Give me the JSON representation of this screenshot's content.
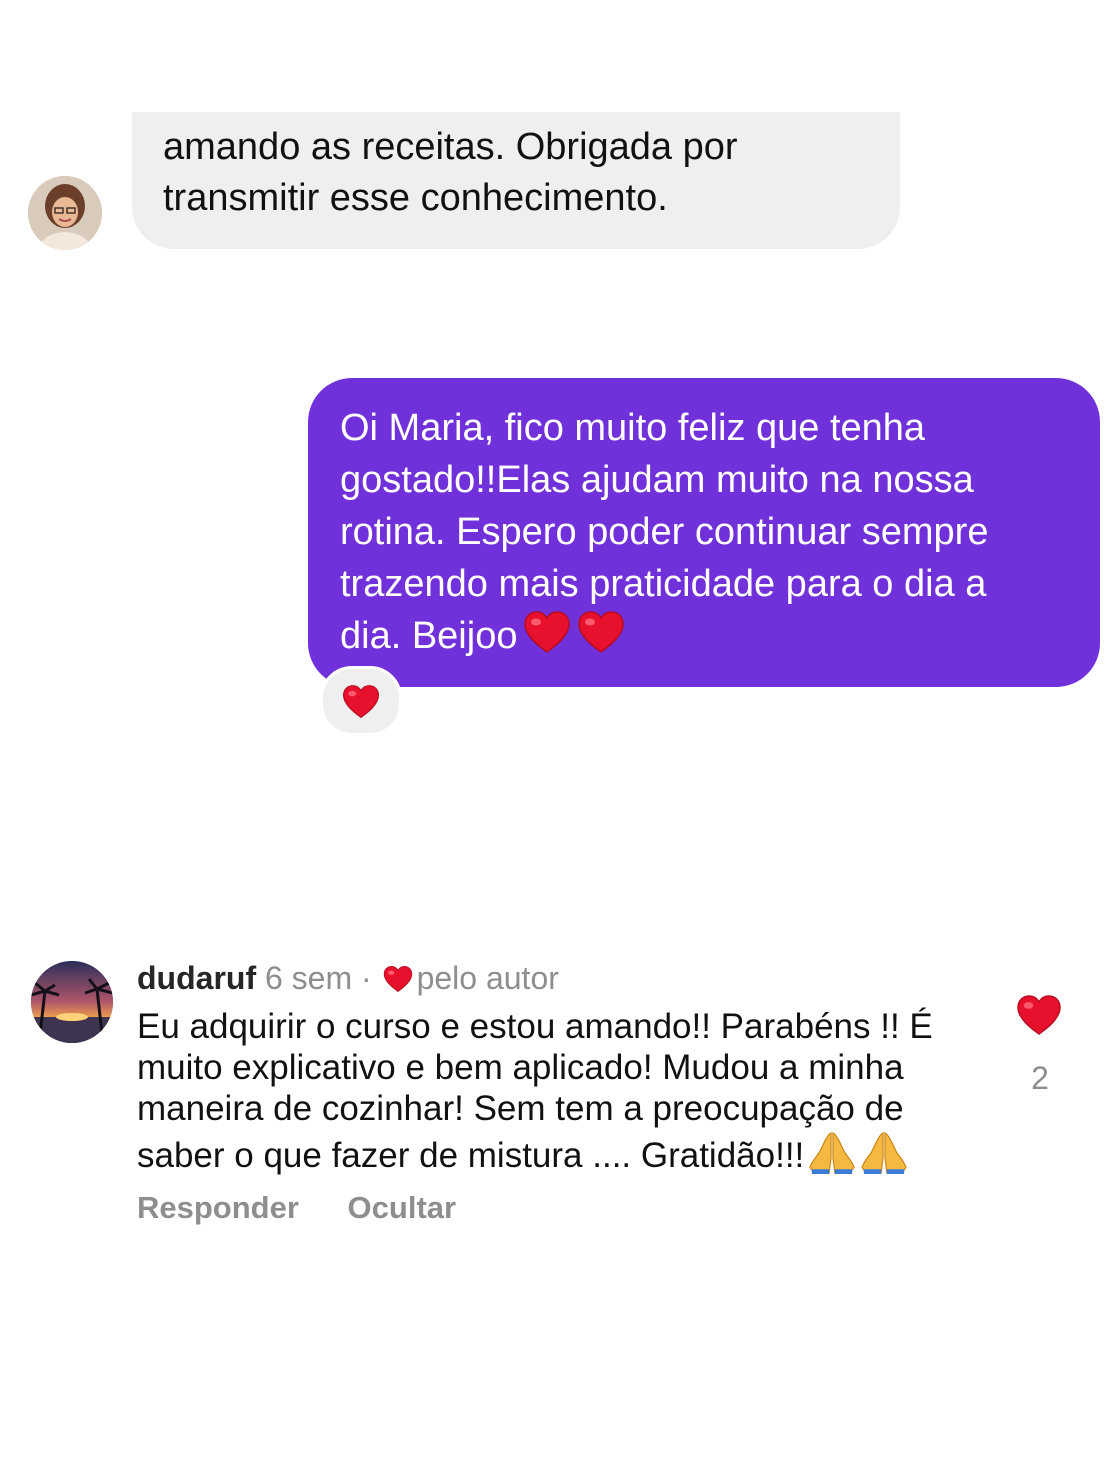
{
  "incoming": {
    "line1": "amando as receitas. Obrigada por",
    "line2": "transmitir esse conhecimento."
  },
  "outgoing": {
    "line1": "Oi Maria, fico muito feliz que tenha",
    "line2": "gostado!!Elas ajudam muito na nossa",
    "line3": "rotina. Espero poder continuar sempre",
    "line4": "trazendo mais praticidade para o dia a",
    "line5": "dia. Beijoo",
    "reaction": "heart-icon"
  },
  "comment": {
    "username": "dudaruf",
    "time": "6 sem",
    "separator": "·",
    "liked_by": "pelo autor",
    "line1": "Eu adquirir o curso e estou amando!! Parabéns !! É",
    "line2": "muito explicativo e bem aplicado! Mudou a minha",
    "line3": "maneira de cozinhar! Sem tem a preocupação de",
    "line4": "saber o que fazer de mistura .... Gratidão!!!",
    "like_count": "2",
    "reply_label": "Responder",
    "hide_label": "Ocultar"
  },
  "colors": {
    "outgoing_bubble": "#7030da",
    "incoming_bubble": "#efefef",
    "heart": "#e8112d",
    "muted_text": "#8e8e8e"
  }
}
